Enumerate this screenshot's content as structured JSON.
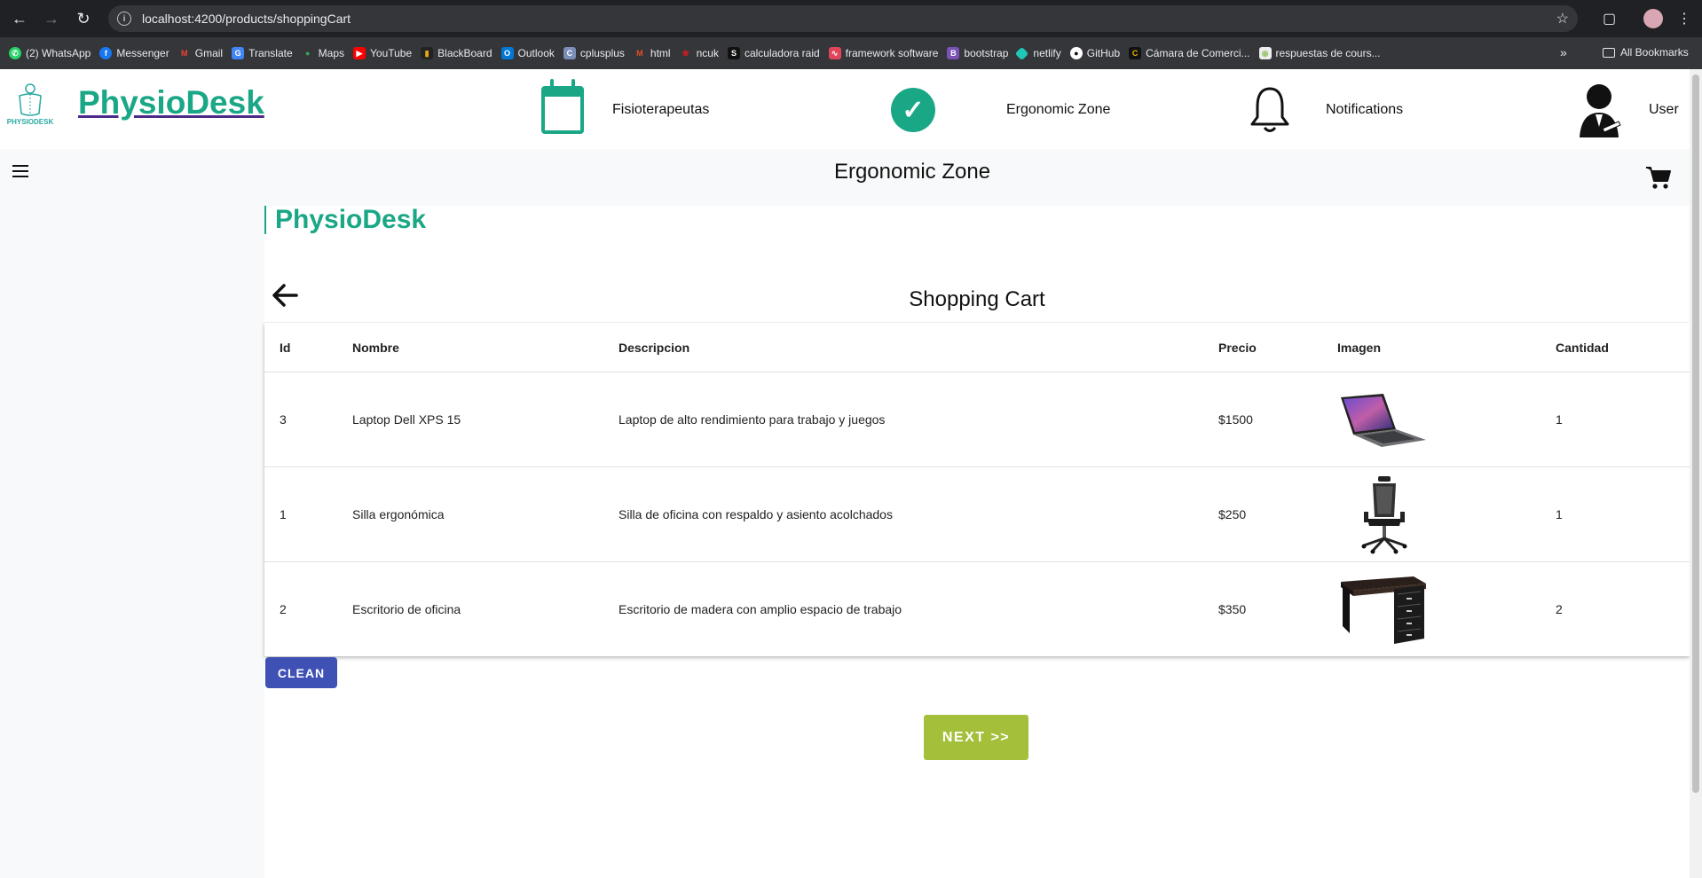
{
  "browser": {
    "url": "localhost:4200/products/shoppingCart",
    "bookmarks": [
      {
        "label": "(2) WhatsApp",
        "color": "#25d366"
      },
      {
        "label": "Messenger",
        "color": "#1877f2"
      },
      {
        "label": "Gmail",
        "color": "#ea4335"
      },
      {
        "label": "Translate",
        "color": "#4285f4"
      },
      {
        "label": "Maps",
        "color": "#34a853"
      },
      {
        "label": "YouTube",
        "color": "#ff0000"
      },
      {
        "label": "BlackBoard",
        "color": "#e8a317"
      },
      {
        "label": "Outlook",
        "color": "#0078d4"
      },
      {
        "label": "cplusplus",
        "color": "#7a8fb7"
      },
      {
        "label": "html",
        "color": "#e44d26"
      },
      {
        "label": "ncuk",
        "color": "#d01c1f"
      },
      {
        "label": "calculadora raid",
        "color": "#111111"
      },
      {
        "label": "framework software",
        "color": "#e0455a"
      },
      {
        "label": "bootstrap",
        "color": "#7952b3"
      },
      {
        "label": "netlify",
        "color": "#20c6b7"
      },
      {
        "label": "GitHub",
        "color": "#ffffff"
      },
      {
        "label": "Cámara de Comerci...",
        "color": "#f0b400"
      },
      {
        "label": "respuestas de cours...",
        "color": "#9bc870"
      }
    ],
    "all_bookmarks": "All Bookmarks"
  },
  "header": {
    "brand": "PhysioDesk",
    "nav": {
      "fisio": "Fisioterapeutas",
      "ergonomic": "Ergonomic Zone",
      "notifications": "Notifications",
      "user": "User"
    },
    "accent": "#1aa786"
  },
  "toolbar": {
    "title": "Ergonomic Zone"
  },
  "content": {
    "brand": "PhysioDesk",
    "title": "Shopping Cart",
    "columns": [
      "Id",
      "Nombre",
      "Descripcion",
      "Precio",
      "Imagen",
      "Cantidad"
    ],
    "rows": [
      {
        "id": "3",
        "nombre": "Laptop Dell XPS 15",
        "descripcion": "Laptop de alto rendimiento para trabajo y juegos",
        "precio": "$1500",
        "imagen": "laptop-image",
        "cantidad": "1"
      },
      {
        "id": "1",
        "nombre": "Silla ergonómica",
        "descripcion": "Silla de oficina con respaldo y asiento acolchados",
        "precio": "$250",
        "imagen": "chair-image",
        "cantidad": "1"
      },
      {
        "id": "2",
        "nombre": "Escritorio de oficina",
        "descripcion": "Escritorio de madera con amplio espacio de trabajo",
        "precio": "$350",
        "imagen": "desk-image",
        "cantidad": "2"
      }
    ],
    "clean_label": "CLEAN",
    "next_label": "NEXT >>",
    "clean_color": "#3f51b5",
    "next_color": "#a4c03b"
  }
}
